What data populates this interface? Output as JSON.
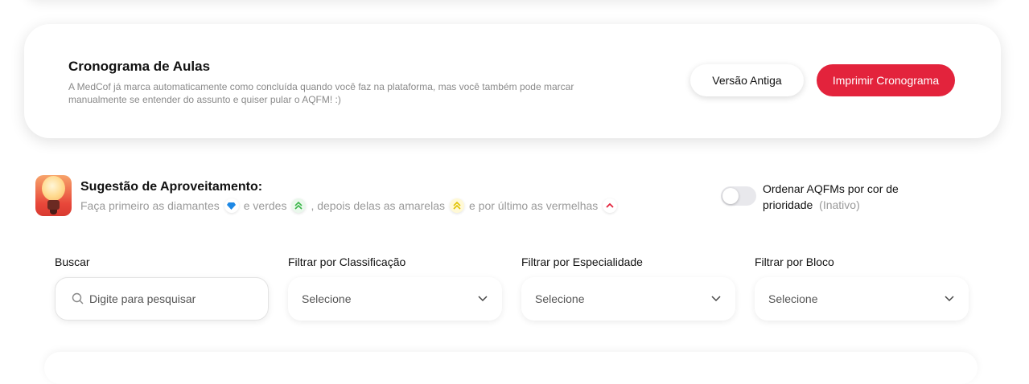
{
  "schedule": {
    "title": "Cronograma de Aulas",
    "description": "A MedCof já marca automaticamente como concluída quando você faz na plataforma, mas você também pode marcar manualmente se entender do assunto e quiser pular o AQFM! :)",
    "old_version_label": "Versão Antiga",
    "print_label": "Imprimir Cronograma",
    "accent_color": "#e3233c"
  },
  "suggestion": {
    "title": "Sugestão de Aproveitamento:",
    "part1": "Faça primeiro as diamantes",
    "part2": "e verdes",
    "part3": ", depois delas as amarelas",
    "part4": "e por último as vermelhas",
    "icons": [
      "lightbulb-icon",
      "diamond-priority-icon",
      "green-priority-icon",
      "yellow-priority-icon",
      "red-priority-icon"
    ]
  },
  "toggle": {
    "label": "Ordenar AQFMs por cor de prioridade",
    "state": "(Inativo)",
    "on": false
  },
  "filters": {
    "search_label": "Buscar",
    "search_placeholder": "Digite para pesquisar",
    "classification_label": "Filtrar por Classificação",
    "classification_value": "Selecione",
    "specialty_label": "Filtrar por Especialidade",
    "specialty_value": "Selecione",
    "block_label": "Filtrar por Bloco",
    "block_value": "Selecione"
  }
}
